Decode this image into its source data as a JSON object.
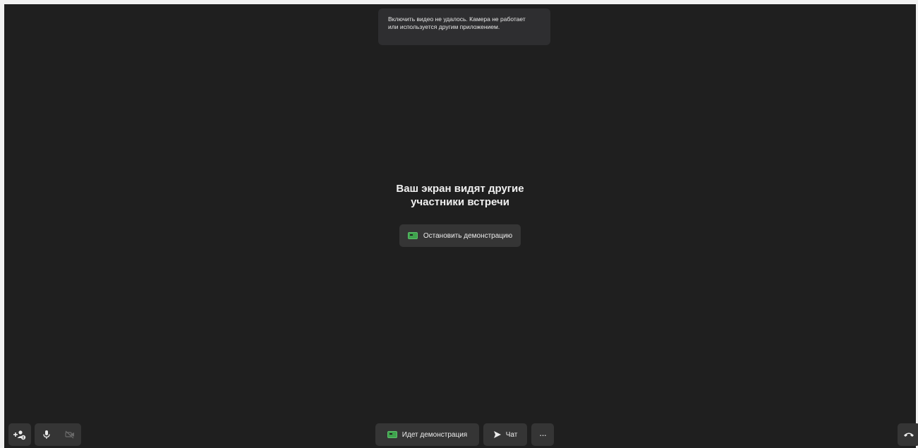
{
  "toast": {
    "line1": "Включить видео не удалось. Камера не работает",
    "line2": "или используется другим приложением."
  },
  "center": {
    "title_line1": "Ваш экран видят другие",
    "title_line2": "участники встречи",
    "stop_label": "Остановить демонстрацию"
  },
  "toolbar": {
    "demo_label": "Идет демонстрация",
    "chat_label": "Чат",
    "more_label": "···"
  },
  "colors": {
    "background": "#1f1f1f",
    "button": "#353535",
    "screen_share_green": "#3fa34d"
  },
  "icons": {
    "invite": "add-user-icon",
    "mic": "microphone-icon",
    "camera": "camera-off-icon",
    "screen": "screen-share-icon",
    "chat": "send-icon",
    "hangup": "phone-hangup-icon"
  }
}
